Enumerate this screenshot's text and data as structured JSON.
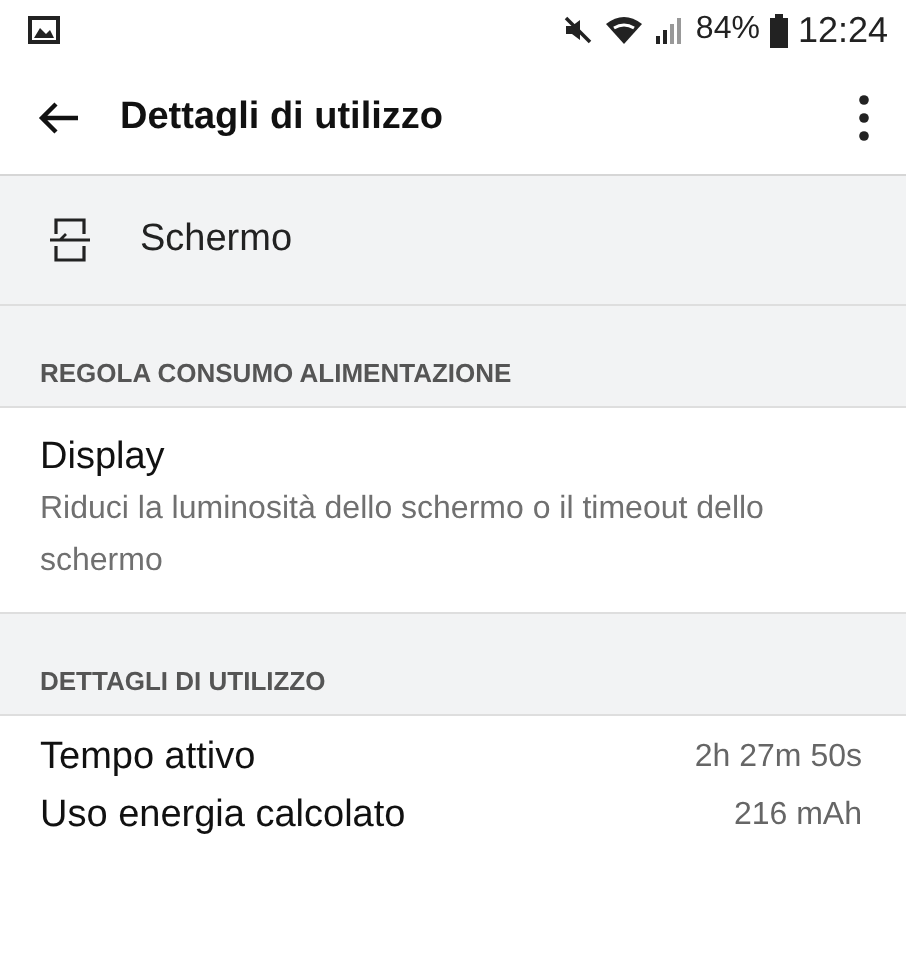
{
  "status_bar": {
    "battery": "84%",
    "time": "12:24"
  },
  "toolbar": {
    "title": "Dettagli di utilizzo"
  },
  "app": {
    "name": "Schermo"
  },
  "sections": [
    {
      "header": "REGOLA CONSUMO ALIMENTAZIONE",
      "kind": "items",
      "items": [
        {
          "title": "Display",
          "summary": "Riduci la luminosità dello schermo o il timeout dello schermo"
        }
      ]
    },
    {
      "header": "DETTAGLI DI UTILIZZO",
      "kind": "stats",
      "items": [
        {
          "label": "Tempo attivo",
          "value": "2h 27m 50s"
        },
        {
          "label": "Uso energia calcolato",
          "value": "216 mAh"
        }
      ]
    }
  ]
}
